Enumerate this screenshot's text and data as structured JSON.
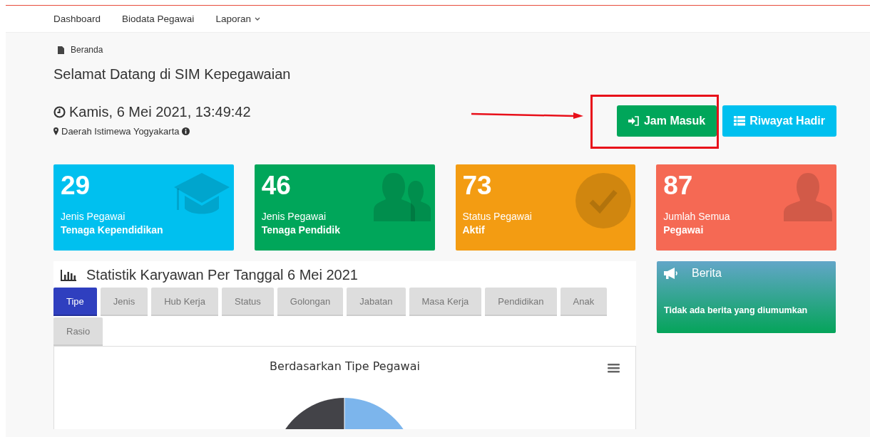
{
  "nav": {
    "items": [
      {
        "label": "Dashboard",
        "kind": "link"
      },
      {
        "label": "Biodata Pegawai",
        "kind": "link"
      },
      {
        "label": "Laporan",
        "kind": "dropdown"
      }
    ]
  },
  "breadcrumb": "Beranda",
  "page_title": "Selamat Datang di SIM Kepegawaian",
  "datetime": "Kamis, 6 Mei 2021, 13:49:42",
  "location": "Daerah Istimewa Yogyakarta",
  "buttons": [
    {
      "label": "Jam Masuk",
      "kind": "login"
    },
    {
      "label": "Riwayat Hadir",
      "kind": "history"
    }
  ],
  "stat_cards": [
    {
      "value": "29",
      "label": "Jenis Pegawai",
      "sublabel": "Tenaga Kependidikan",
      "kind": "cap"
    },
    {
      "value": "46",
      "label": "Jenis Pegawai",
      "sublabel": "Tenaga Pendidik",
      "kind": "users"
    },
    {
      "value": "73",
      "label": "Status Pegawai",
      "sublabel": "Aktif",
      "kind": "check"
    },
    {
      "value": "87",
      "label": "Jumlah Semua",
      "sublabel": "Pegawai",
      "kind": "user"
    }
  ],
  "stats_panel": {
    "title": "Statistik Karyawan Per Tanggal 6 Mei 2021",
    "tabs": [
      {
        "label": "Tipe",
        "selected": true
      },
      {
        "label": "Jenis",
        "selected": false
      },
      {
        "label": "Hub Kerja",
        "selected": false
      },
      {
        "label": "Status",
        "selected": false
      },
      {
        "label": "Golongan",
        "selected": false
      },
      {
        "label": "Jabatan",
        "selected": false
      },
      {
        "label": "Masa Kerja",
        "selected": false
      },
      {
        "label": "Pendidikan",
        "selected": false
      },
      {
        "label": "Anak",
        "selected": false
      },
      {
        "label": "Rasio",
        "selected": false
      }
    ],
    "chart_title": "Berdasarkan Tipe Pegawai"
  },
  "news": {
    "title": "Berita",
    "message": "Tidak ada berita yang diumumkan"
  }
}
